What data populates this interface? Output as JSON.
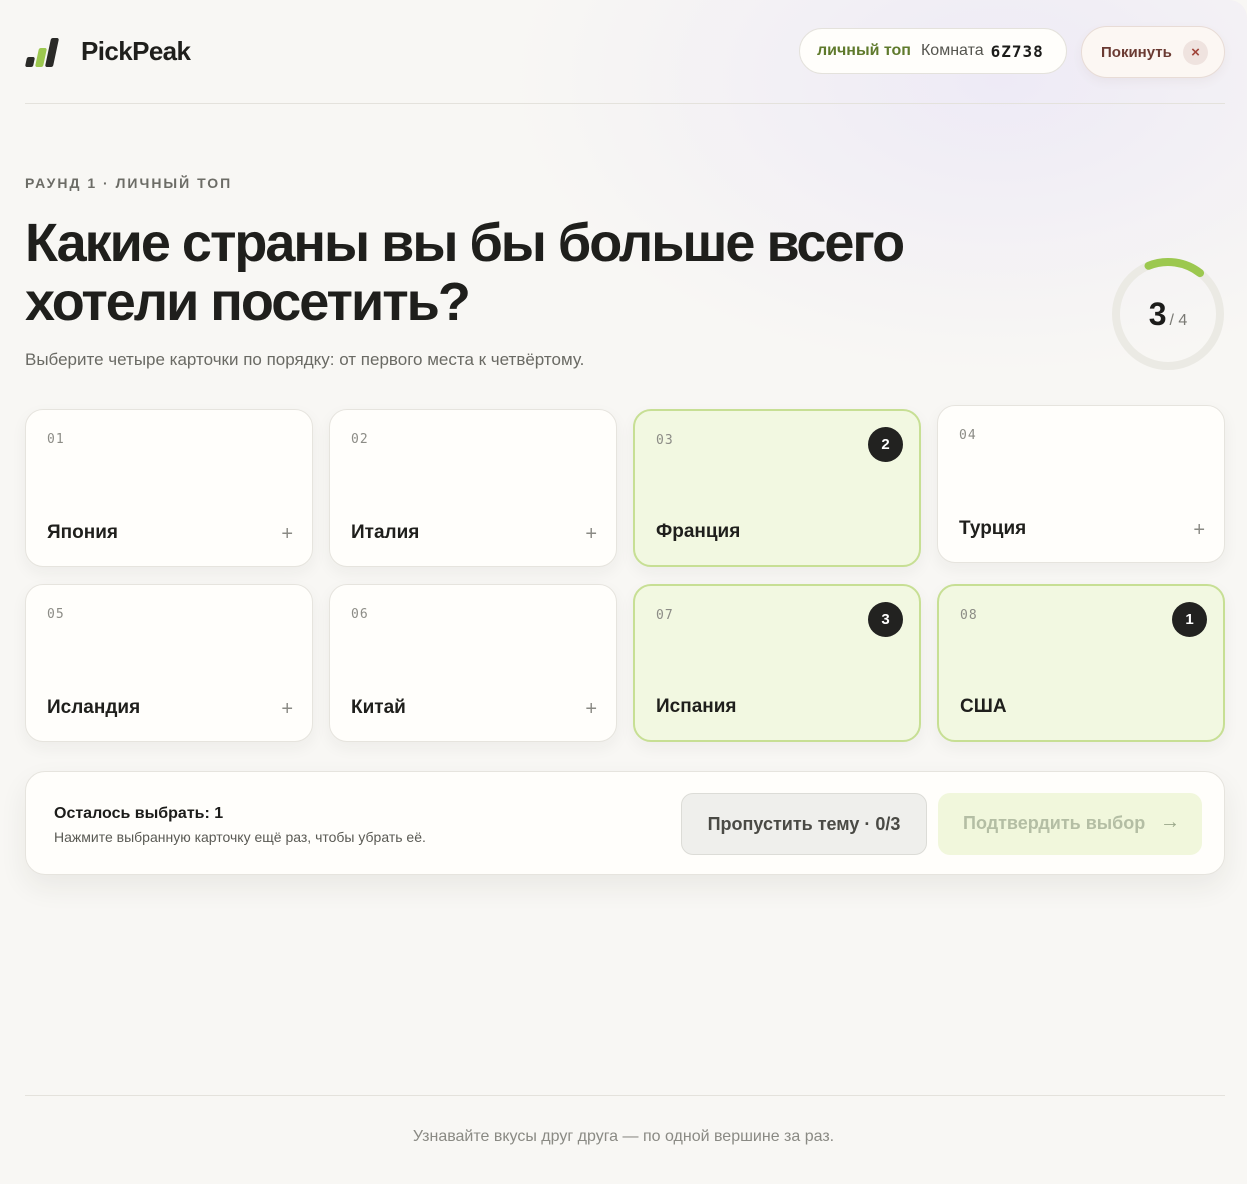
{
  "app": {
    "name": "PickPeak",
    "room_mode": "личный топ",
    "room_label": "Комната",
    "room_code": "6Z738",
    "leave_label": "Покинуть",
    "leave_icon": "×"
  },
  "round": {
    "label": "РАУНД 1 · ЛИЧНЫЙ ТОП",
    "question": "Какие страны вы бы больше всего хотели посетить?",
    "hint": "Выберите четыре карточки по порядку: от первого места к четвёртому."
  },
  "progress": {
    "current": "3",
    "total": "/ 4",
    "fraction": 0.75
  },
  "cards": [
    {
      "num": "01",
      "name": "Япония",
      "selected": false,
      "rank": ""
    },
    {
      "num": "02",
      "name": "Италия",
      "selected": false,
      "rank": ""
    },
    {
      "num": "03",
      "name": "Франция",
      "selected": true,
      "rank": "2"
    },
    {
      "num": "04",
      "name": "Турция",
      "selected": false,
      "rank": ""
    },
    {
      "num": "05",
      "name": "Исландия",
      "selected": false,
      "rank": ""
    },
    {
      "num": "06",
      "name": "Китай",
      "selected": false,
      "rank": ""
    },
    {
      "num": "07",
      "name": "Испания",
      "selected": true,
      "rank": "3"
    },
    {
      "num": "08",
      "name": "США",
      "selected": true,
      "rank": "1"
    }
  ],
  "card_plus": "+",
  "action": {
    "remaining": "Осталось выбрать: 1",
    "remaining_hint": "Нажмите выбранную карточку ещё раз, чтобы убрать её.",
    "skip_label": "Пропустить тему · 0/3",
    "confirm_label": "Подтвердить выбор",
    "confirm_icon": "→"
  },
  "footer": {
    "tagline": "Узнавайте вкусы друг друга — по одной вершине за раз."
  },
  "colors": {
    "accent": "#9cc84f",
    "selected_bg": "#f2f8e1",
    "selected_border": "#c7df94",
    "ring_track": "#ebeae4"
  }
}
